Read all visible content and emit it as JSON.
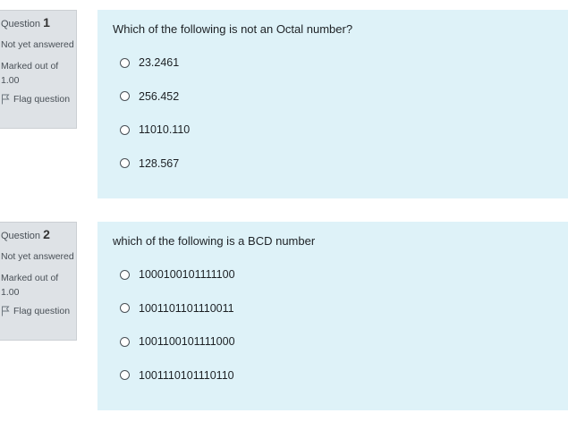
{
  "questions": [
    {
      "label": "Question",
      "number": "1",
      "state": "Not yet answered",
      "grade": "Marked out of 1.00",
      "flag_label": "Flag question",
      "text": "Which of the following is not an Octal number?",
      "options": [
        "23.2461",
        "256.452",
        "11010.110",
        "128.567"
      ]
    },
    {
      "label": "Question",
      "number": "2",
      "state": "Not yet answered",
      "grade": "Marked out of 1.00",
      "flag_label": "Flag question",
      "text": "which of the following is a BCD number",
      "options": [
        "1000100101111100",
        "1001101101110011",
        "1001100101111000",
        "1001110101110110"
      ]
    }
  ],
  "colors": {
    "info_bg": "#dee2e6",
    "content_bg": "#def2f8"
  },
  "icons": {
    "flag": "flag-icon",
    "radio": "radio-unchecked-icon"
  }
}
